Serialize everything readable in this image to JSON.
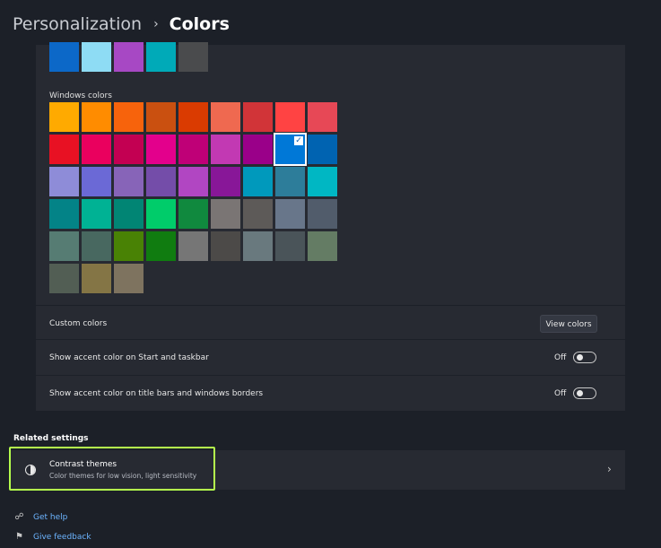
{
  "breadcrumb": {
    "parent": "Personalization",
    "separator": "›",
    "current": "Colors"
  },
  "recent_colors": [
    "#0c68c8",
    "#8edcf4",
    "#a748c4",
    "#00aab8",
    "#4a4b4d"
  ],
  "windows_colors": {
    "label": "Windows colors",
    "rows": [
      [
        "#ffaa00",
        "#ff8c00",
        "#f7630c",
        "#ca5010",
        "#da3b01",
        "#ef6950",
        "#d13438",
        "#ff4343",
        "#e74856"
      ],
      [
        "#e81123",
        "#ea005e",
        "#c30052",
        "#e3008c",
        "#bf0077",
        "#c239b3",
        "#9a0089",
        "#0078d7",
        "#0063b1"
      ],
      [
        "#8e8cd8",
        "#6b69d6",
        "#8764b8",
        "#744da9",
        "#b146c2",
        "#881798",
        "#0099bc",
        "#2d7d9a",
        "#00b7c3"
      ],
      [
        "#038387",
        "#00b294",
        "#018574",
        "#00cc6a",
        "#10893e",
        "#7a7574",
        "#5d5a58",
        "#68768a",
        "#515c6b"
      ],
      [
        "#567c73",
        "#486860",
        "#498205",
        "#107c10",
        "#767676",
        "#4c4a48",
        "#69797e",
        "#4a5459",
        "#647c64"
      ],
      [
        "#525e54",
        "#847545",
        "#7e735f"
      ]
    ],
    "selected_index": [
      1,
      7
    ]
  },
  "custom_colors": {
    "label": "Custom colors",
    "button": "View colors"
  },
  "accent_start": {
    "label": "Show accent color on Start and taskbar",
    "state": "Off"
  },
  "accent_title": {
    "label": "Show accent color on title bars and windows borders",
    "state": "Off"
  },
  "related": {
    "heading": "Related settings",
    "contrast": {
      "title": "Contrast themes",
      "subtitle": "Color themes for low vision, light sensitivity"
    }
  },
  "links": {
    "help": "Get help",
    "feedback": "Give feedback"
  }
}
